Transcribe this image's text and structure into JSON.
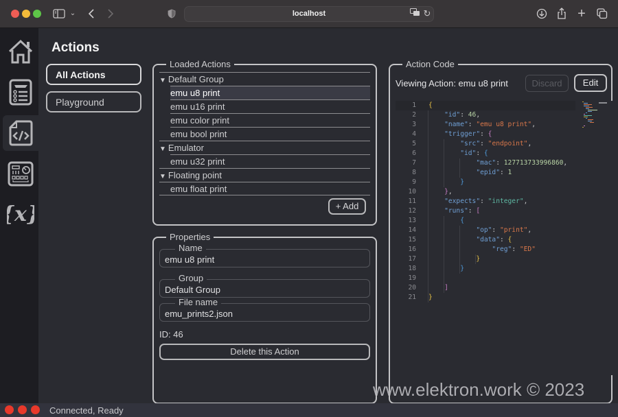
{
  "browser": {
    "url": "localhost",
    "icons": [
      "sidebar-toggle-icon",
      "chevron-down-icon",
      "back-icon",
      "forward-icon",
      "shield-icon",
      "translate-icon",
      "reload-icon",
      "download-icon",
      "share-icon",
      "new-tab-icon",
      "tab-overview-icon"
    ]
  },
  "rail": {
    "items": [
      {
        "name": "home",
        "icon": "home-icon",
        "active": false
      },
      {
        "name": "flight-list",
        "icon": "flight-list-icon",
        "active": false
      },
      {
        "name": "actions",
        "icon": "code-file-icon",
        "active": true
      },
      {
        "name": "control-panel",
        "icon": "control-panel-icon",
        "active": false
      },
      {
        "name": "variables",
        "icon": "variables-icon",
        "active": false
      }
    ]
  },
  "page": {
    "title": "Actions",
    "nav": [
      {
        "label": "All Actions",
        "active": true
      },
      {
        "label": "Playground",
        "active": false
      }
    ]
  },
  "loaded_actions": {
    "legend": "Loaded Actions",
    "groups": [
      {
        "label": "Default Group",
        "items": [
          "emu u8 print",
          "emu u16 print",
          "emu color print",
          "emu bool print"
        ]
      },
      {
        "label": "Emulator",
        "items": [
          "emu u32 print"
        ]
      },
      {
        "label": "Floating point",
        "items": [
          "emu float print"
        ]
      }
    ],
    "selected": "emu u8 print",
    "add_label": "+ Add"
  },
  "properties": {
    "legend": "Properties",
    "name_label": "Name",
    "name_value": "emu u8 print",
    "group_label": "Group",
    "group_value": "Default Group",
    "file_label": "File name",
    "file_value": "emu_prints2.json",
    "id_text": "ID: 46",
    "delete_label": "Delete this Action"
  },
  "action_code": {
    "legend": "Action Code",
    "viewing": "Viewing Action: emu u8 print",
    "discard_label": "Discard",
    "edit_label": "Edit",
    "lines": [
      "{",
      "    \"id\": 46,",
      "    \"name\": \"emu u8 print\",",
      "    \"trigger\": {",
      "        \"src\": \"endpoint\",",
      "        \"id\": {",
      "            \"mac\": 127713733996860,",
      "            \"epid\": 1",
      "        }",
      "    },",
      "    \"expects\": \"integer\",",
      "    \"runs\": [",
      "        {",
      "            \"op\": \"print\",",
      "            \"data\": {",
      "                \"reg\": \"ED\"",
      "            }",
      "        }",
      "",
      "    ]",
      "}"
    ]
  },
  "status": {
    "text": "Connected, Ready",
    "dot_color": "#e8392b"
  },
  "watermark": "www.elektron.work © 2023"
}
